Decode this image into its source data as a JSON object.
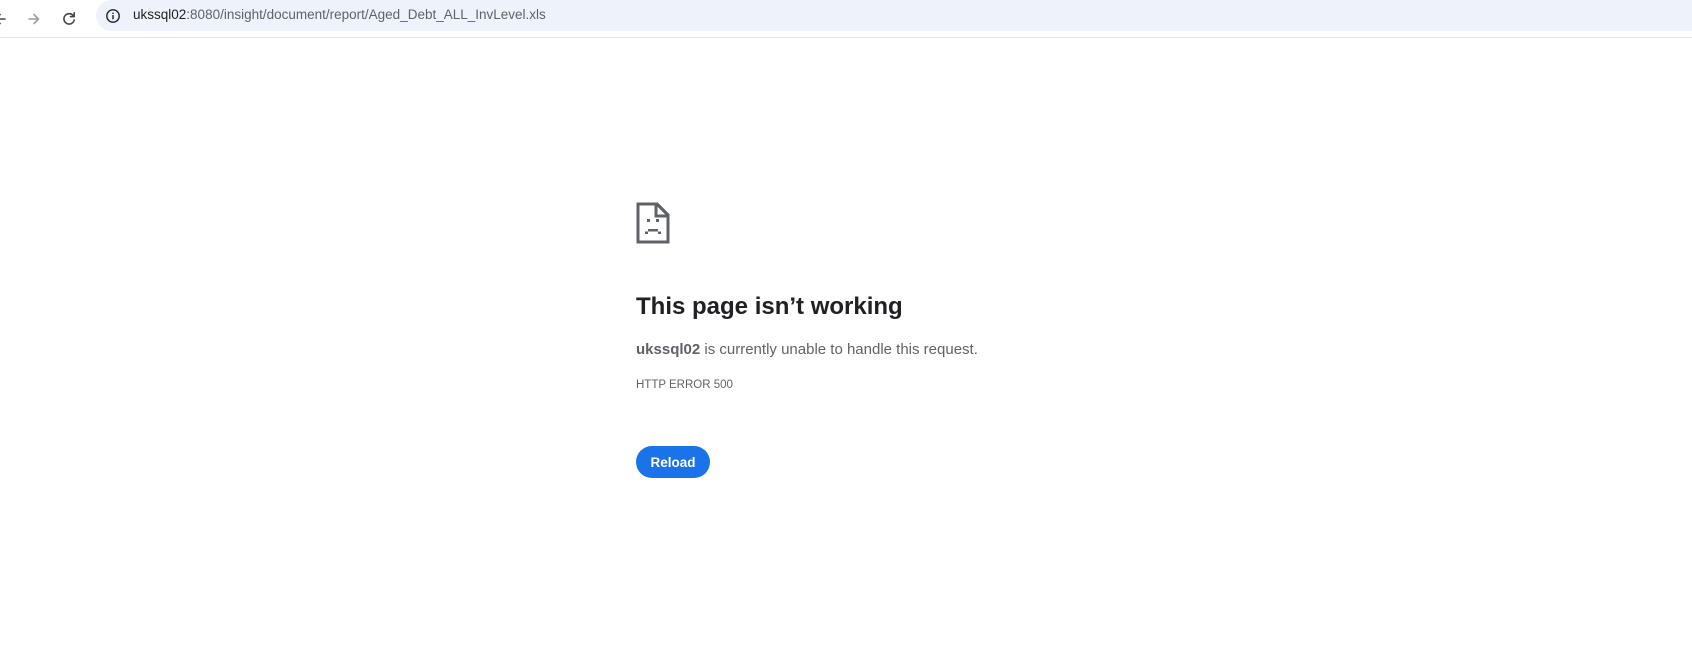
{
  "toolbar": {
    "back_icon": "back-arrow-icon",
    "forward_icon": "forward-arrow-icon",
    "reload_icon": "reload-icon",
    "site_info_icon": "info-icon",
    "url_host": "ukssql02",
    "url_rest": ":8080/insight/document/report/Aged_Debt_ALL_InvLevel.xls"
  },
  "error": {
    "icon": "sad-page-icon",
    "title": "This page isn’t working",
    "host": "ukssql02",
    "description_rest": " is currently unable to handle this request.",
    "code": "HTTP ERROR 500",
    "reload_label": "Reload"
  },
  "colors": {
    "accent": "#1a73e8",
    "omnibox_bg": "#eef2fa",
    "text_primary": "#202124",
    "text_secondary": "#5f6368"
  }
}
